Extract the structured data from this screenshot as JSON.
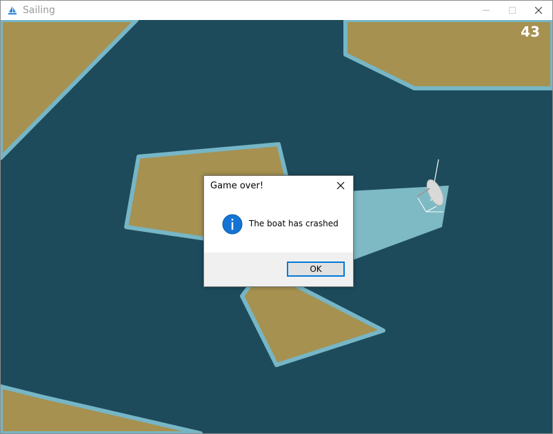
{
  "window": {
    "title": "Sailing",
    "icon": "sailboat-icon",
    "controls": [
      "minimize-icon",
      "maximize-icon",
      "close-icon"
    ]
  },
  "game": {
    "score": "43",
    "colors": {
      "water": "#1d4b5c",
      "land": "#a69150",
      "shore": "#76b6c6",
      "wake": "#7ebac4",
      "boat": "#d9d9d9"
    }
  },
  "dialog": {
    "title": "Game over!",
    "message": "The boat has crashed",
    "ok_label": "OK",
    "icon": "info-icon"
  }
}
